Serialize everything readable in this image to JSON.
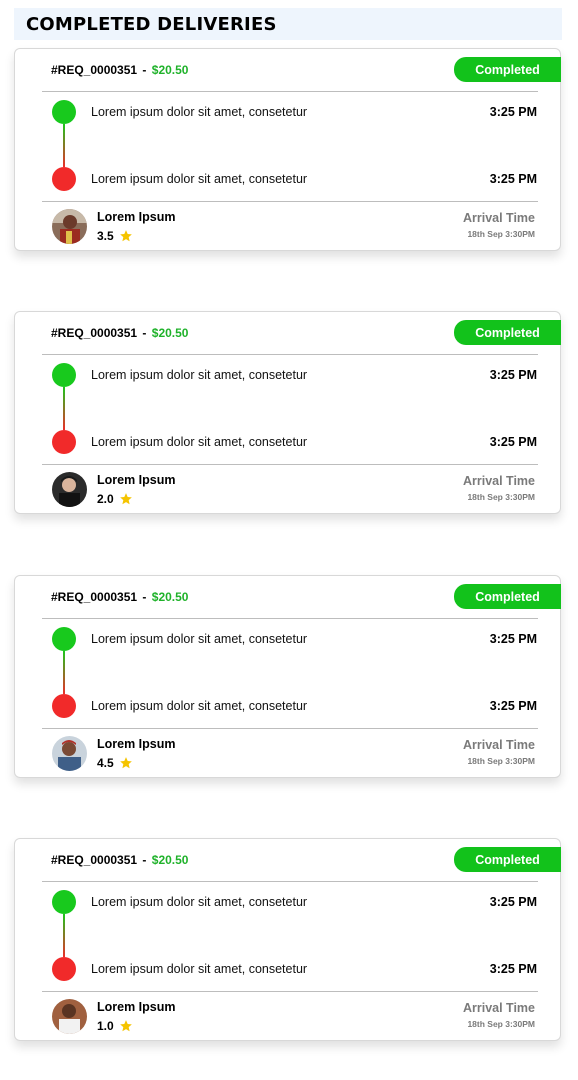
{
  "page": {
    "title": "COMPLETED DELIVERIES"
  },
  "deliveries": [
    {
      "request_id": "#REQ_0000351",
      "separator": "-",
      "price": "$20.50",
      "status": "Completed",
      "pickup": {
        "text": "Lorem ipsum dolor sit amet, consetetur",
        "time": "3:25 PM"
      },
      "drop": {
        "text": "Lorem ipsum dolor sit amet, consetetur",
        "time": "3:25 PM"
      },
      "driver": {
        "name": "Lorem Ipsum",
        "rating": "3.5"
      },
      "arrival": {
        "label": "Arrival Time",
        "value": "18th Sep 3:30PM"
      }
    },
    {
      "request_id": "#REQ_0000351",
      "separator": "-",
      "price": "$20.50",
      "status": "Completed",
      "pickup": {
        "text": "Lorem ipsum dolor sit amet, consetetur",
        "time": "3:25 PM"
      },
      "drop": {
        "text": "Lorem ipsum dolor sit amet, consetetur",
        "time": "3:25 PM"
      },
      "driver": {
        "name": "Lorem Ipsum",
        "rating": "2.0"
      },
      "arrival": {
        "label": "Arrival Time",
        "value": "18th Sep 3:30PM"
      }
    },
    {
      "request_id": "#REQ_0000351",
      "separator": "-",
      "price": "$20.50",
      "status": "Completed",
      "pickup": {
        "text": "Lorem ipsum dolor sit amet, consetetur",
        "time": "3:25 PM"
      },
      "drop": {
        "text": "Lorem ipsum dolor sit amet, consetetur",
        "time": "3:25 PM"
      },
      "driver": {
        "name": "Lorem Ipsum",
        "rating": "4.5"
      },
      "arrival": {
        "label": "Arrival Time",
        "value": "18th Sep 3:30PM"
      }
    },
    {
      "request_id": "#REQ_0000351",
      "separator": "-",
      "price": "$20.50",
      "status": "Completed",
      "pickup": {
        "text": "Lorem ipsum dolor sit amet, consetetur",
        "time": "3:25 PM"
      },
      "drop": {
        "text": "Lorem ipsum dolor sit amet, consetetur",
        "time": "3:25 PM"
      },
      "driver": {
        "name": "Lorem Ipsum",
        "rating": "1.0"
      },
      "arrival": {
        "label": "Arrival Time",
        "value": "18th Sep 3:30PM"
      }
    }
  ],
  "colors": {
    "price_green": "#1fb22a",
    "status_green": "#12c21b",
    "pickup_dot": "#18c91d",
    "drop_dot": "#f12a2a",
    "star": "#f5c400",
    "header_bg": "#eef5fd"
  },
  "icons": {
    "pickup": "green-circle",
    "drop": "red-circle",
    "rating": "star-icon"
  }
}
